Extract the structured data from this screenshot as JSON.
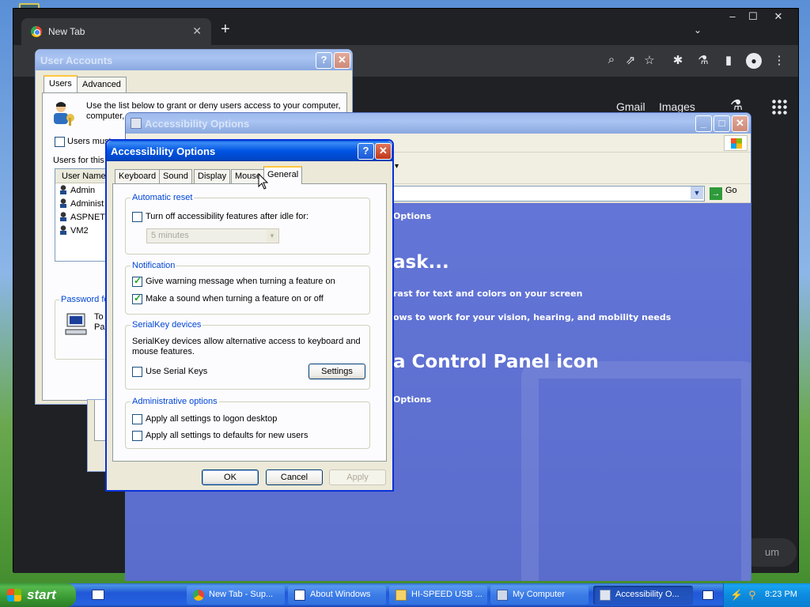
{
  "chrome": {
    "tab_title": "New Tab",
    "tab_close": "✕",
    "new_tab": "+",
    "win_min": "–",
    "win_max": "☐",
    "win_close": "✕",
    "dropdown": "⌄",
    "gmail": "Gmail",
    "images": "Images",
    "customize": "um"
  },
  "user_accounts": {
    "title": "User Accounts",
    "tabs": [
      "Users",
      "Advanced"
    ],
    "intro": "Use the list below to grant or deny users access to your computer,",
    "intro2": "computer,",
    "users_must": "Users must",
    "users_for": "Users for this",
    "list_header": "User Name",
    "users": [
      "Admin",
      "Administ",
      "ASPNET",
      "VM2"
    ],
    "password_label": "Password fo",
    "to": "To",
    "pa": "Pa"
  },
  "control_panel": {
    "title": "Accessibility Options",
    "go": "Go",
    "heading_options": "Options",
    "pick_task": "ask...",
    "task1": "rast for text and colors on your screen",
    "task2": "ows to work for your vision, hearing, and mobility needs",
    "pick_icon": "a Control Panel icon",
    "icon1": "Options"
  },
  "dialog": {
    "title": "Accessibility Options",
    "tabs": [
      "Keyboard",
      "Sound",
      "Display",
      "Mouse",
      "General"
    ],
    "automatic_reset": {
      "label": "Automatic reset",
      "turn_off": "Turn off accessibility features after idle for:",
      "idle_value": "5 minutes"
    },
    "notification": {
      "label": "Notification",
      "warning": "Give warning message when turning a feature on",
      "sound": "Make a sound when turning a feature on or off"
    },
    "serialkey": {
      "label": "SerialKey devices",
      "description": "SerialKey devices allow alternative access to keyboard and",
      "description2": "mouse features.",
      "use_serial": "Use Serial Keys",
      "settings": "Settings"
    },
    "admin": {
      "label": "Administrative options",
      "logon": "Apply all settings to logon desktop",
      "defaults": "Apply all settings to defaults for new users"
    },
    "ok": "OK",
    "cancel": "Cancel",
    "apply": "Apply",
    "checked": {
      "turn_off": false,
      "warning": true,
      "sound": true,
      "use_serial": false,
      "logon": false,
      "defaults": false
    }
  },
  "taskbar": {
    "start": "start",
    "tasks": [
      "New Tab - Sup...",
      "About Windows",
      "HI-SPEED USB ...",
      "My Computer",
      "Accessibility O..."
    ],
    "clock": "8:23 PM"
  }
}
